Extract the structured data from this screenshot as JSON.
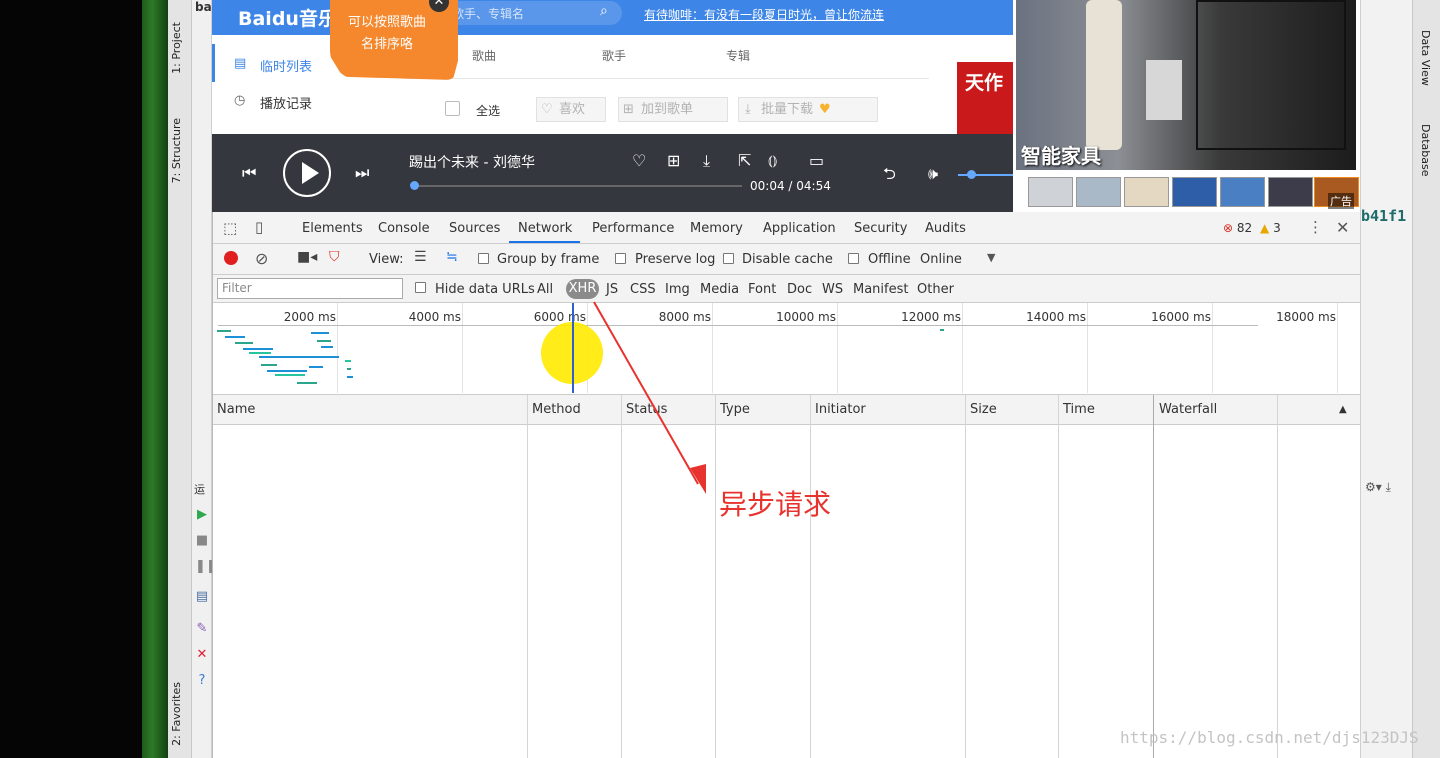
{
  "ide": {
    "left_tabs": [
      "1: Project",
      "7: Structure",
      "2: Favorites"
    ],
    "right_tabs": [
      "Data View",
      "Database"
    ],
    "run_label": "运",
    "code_fragment": "b41f1",
    "top_fragment": "ba"
  },
  "music": {
    "logo": "Bai​du音乐",
    "search_placeholder": "歌手、专辑名",
    "marquee": "有待咖啡：有没有一段夏日时光，曾让你流连",
    "sidebar": [
      "临时列表",
      "播放记录"
    ],
    "columns": [
      "歌曲",
      "歌手",
      "专辑"
    ],
    "select_all": "全选",
    "buttons": [
      "喜欢",
      "加到歌单",
      "批量下载"
    ],
    "tooltip": "可以按照歌曲名排序咯",
    "ad_text": "天作"
  },
  "player": {
    "song": "踢出个未来  -  刘德华",
    "time": "00:04 / 04:54",
    "progress": 0.013,
    "volume": 0.2
  },
  "video_ad": {
    "title": "智能家具",
    "tag": "广告"
  },
  "devtools": {
    "tabs": [
      "Elements",
      "Console",
      "Sources",
      "Network",
      "Performance",
      "Memory",
      "Application",
      "Security",
      "Audits"
    ],
    "active_tab": "Network",
    "errors": "82",
    "warnings": "3",
    "view_label": "View:",
    "options": [
      "Group by frame",
      "Preserve log",
      "Disable cache",
      "Offline",
      "Online"
    ],
    "filter_placeholder": "Filter",
    "hide_data_urls": "Hide data URLs",
    "types": [
      "All",
      "XHR",
      "JS",
      "CSS",
      "Img",
      "Media",
      "Font",
      "Doc",
      "WS",
      "Manifest",
      "Other"
    ],
    "active_type": "XHR",
    "ticks": [
      "2000 ms",
      "4000 ms",
      "6000 ms",
      "8000 ms",
      "10000 ms",
      "12000 ms",
      "14000 ms",
      "16000 ms",
      "18000 ms"
    ],
    "columns": [
      "Name",
      "Method",
      "Status",
      "Type",
      "Initiator",
      "Size",
      "Time",
      "Waterfall"
    ]
  },
  "annotation": "异步请求",
  "watermark": "https://blog.csdn.net/djs123DJS"
}
